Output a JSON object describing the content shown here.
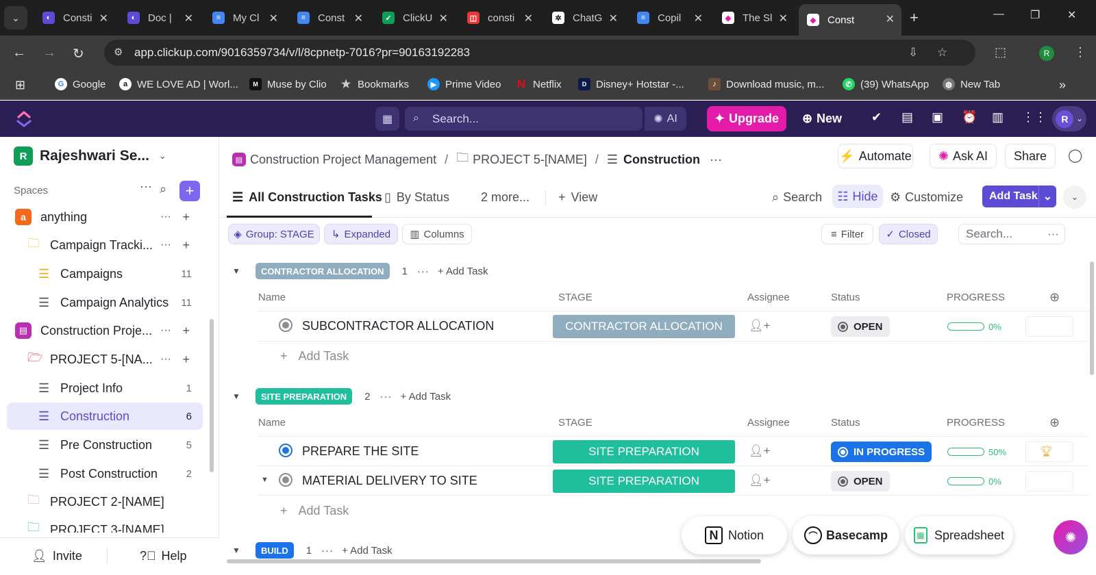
{
  "browser": {
    "tabs": [
      {
        "title": "Consti",
        "color": "#5b4bd5",
        "glyph": "◐"
      },
      {
        "title": "Doc |",
        "color": "#5b4bd5",
        "glyph": "◐"
      },
      {
        "title": "My Cl",
        "color": "#4285f4",
        "glyph": "≡"
      },
      {
        "title": "Const",
        "color": "#4285f4",
        "glyph": "≡"
      },
      {
        "title": "ClickU",
        "color": "#0f9d58",
        "glyph": "✓"
      },
      {
        "title": "consti",
        "color": "#e53935",
        "glyph": "◫"
      },
      {
        "title": "ChatG",
        "color": "#1f1f1f",
        "glyph": "✲"
      },
      {
        "title": "Copil",
        "color": "#4285f4",
        "glyph": "≡"
      },
      {
        "title": "The Sl",
        "color": "#ffffff",
        "glyph": "◆"
      },
      {
        "title": "Const",
        "color": "#ffffff",
        "glyph": "◆"
      }
    ],
    "url": "app.clickup.com/9016359734/v/l/8cpnetp-7016?pr=90163192283",
    "profile_initial": "R",
    "bookmarks": [
      {
        "label": "Google",
        "icon": "google-icon"
      },
      {
        "label": "WE LOVE AD | Worl...",
        "icon": "adsoftheworld-icon"
      },
      {
        "label": "Muse by Clio",
        "icon": "muse-icon"
      },
      {
        "label": "Bookmarks",
        "icon": "star-icon"
      },
      {
        "label": "Prime Video",
        "icon": "prime-video-icon"
      },
      {
        "label": "Netflix",
        "icon": "netflix-icon"
      },
      {
        "label": "Disney+ Hotstar -...",
        "icon": "hotstar-icon"
      },
      {
        "label": "Download music, m...",
        "icon": "download-music-icon"
      },
      {
        "label": "(39) WhatsApp",
        "icon": "whatsapp-icon"
      },
      {
        "label": "New Tab",
        "icon": "globe-icon"
      }
    ]
  },
  "topbar": {
    "search_placeholder": "Search...",
    "ai_label": "AI",
    "upgrade_label": "Upgrade",
    "new_label": "New",
    "user_initial": "R"
  },
  "sidebar": {
    "workspace_initial": "R",
    "workspace_name": "Rajeshwari Se...",
    "spaces_label": "Spaces",
    "items": [
      {
        "label": "anything",
        "count": ""
      },
      {
        "label": "Campaign Tracki...",
        "count": ""
      },
      {
        "label": "Campaigns",
        "count": "11"
      },
      {
        "label": "Campaign Analytics",
        "count": "11"
      },
      {
        "label": "Construction Proje...",
        "count": ""
      },
      {
        "label": "PROJECT 5-[NA...",
        "count": ""
      },
      {
        "label": "Project Info",
        "count": "1"
      },
      {
        "label": "Construction",
        "count": "6"
      },
      {
        "label": "Pre Construction",
        "count": "5"
      },
      {
        "label": "Post Construction",
        "count": "2"
      },
      {
        "label": "PROJECT 2-[NAME]",
        "count": ""
      },
      {
        "label": "PROJECT 3-[NAME]",
        "count": ""
      }
    ],
    "space_initial": "a",
    "invite_label": "Invite",
    "help_label": "Help"
  },
  "header": {
    "breadcrumbs": [
      "Construction Project Management",
      "PROJECT 5-[NAME]",
      "Construction"
    ],
    "automate_label": "Automate",
    "ask_ai_label": "Ask AI",
    "share_label": "Share"
  },
  "views": {
    "tabs": [
      "All Construction Tasks",
      "By Status",
      "2 more...",
      "View"
    ],
    "search_label": "Search",
    "hide_label": "Hide",
    "customize_label": "Customize",
    "add_task_label": "Add Task"
  },
  "filters": {
    "group_label": "Group: STAGE",
    "expanded_label": "Expanded",
    "columns_label": "Columns",
    "filter_label": "Filter",
    "closed_label": "Closed",
    "search_placeholder": "Search..."
  },
  "columns": {
    "name": "Name",
    "stage": "STAGE",
    "assignee": "Assignee",
    "status": "Status",
    "progress": "PROGRESS"
  },
  "groups": [
    {
      "label": "CONTRACTOR ALLOCATION",
      "color": "#8fadbf",
      "count": "1",
      "add_task_label": "Add Task",
      "tasks": [
        {
          "name": "SUBCONTRACTOR ALLOCATION",
          "stage": "CONTRACTOR ALLOCATION",
          "status": "OPEN",
          "progress": 0,
          "progress_text": "0%"
        }
      ]
    },
    {
      "label": "SITE PREPARATION",
      "color": "#1fbe9c",
      "count": "2",
      "add_task_label": "Add Task",
      "tasks": [
        {
          "name": "PREPARE THE SITE",
          "stage": "SITE PREPARATION",
          "status": "IN PROGRESS",
          "progress": 50,
          "progress_text": "50%"
        },
        {
          "name": "MATERIAL DELIVERY TO SITE",
          "stage": "SITE PREPARATION",
          "status": "OPEN",
          "progress": 0,
          "progress_text": "0%"
        }
      ]
    },
    {
      "label": "BUILD",
      "color": "#1a73e8",
      "count": "1",
      "add_task_label": "Add Task",
      "tasks": []
    }
  ],
  "row_add_label": "Add Task",
  "import_buttons": [
    {
      "label": "Notion",
      "icon": "notion-icon"
    },
    {
      "label": "Basecamp",
      "icon": "basecamp-icon"
    },
    {
      "label": "Spreadsheet",
      "icon": "spreadsheet-icon"
    }
  ],
  "colors": {
    "accent": "#5b4bd5",
    "topbar": "#2a1e55",
    "upgrade": "#e41ba9",
    "in_progress": "#1a73e8",
    "progress_green": "#2fbf71"
  }
}
